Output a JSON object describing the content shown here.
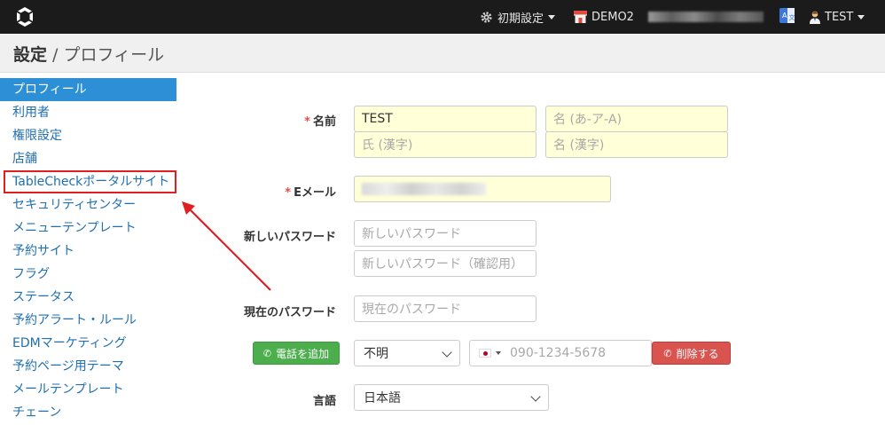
{
  "topbar": {
    "initial_settings": "初期設定",
    "store_name": "DEMO2",
    "user_name": "TEST"
  },
  "header": {
    "title_main": "設定",
    "title_separator": " / ",
    "title_sub": "プロフィール"
  },
  "sidebar": {
    "items": [
      {
        "label": "プロフィール"
      },
      {
        "label": "利用者"
      },
      {
        "label": "権限設定"
      },
      {
        "label": "店舗"
      },
      {
        "label": "TableCheckポータルサイト"
      },
      {
        "label": "セキュリティセンター"
      },
      {
        "label": "メニューテンプレート"
      },
      {
        "label": "予約サイト"
      },
      {
        "label": "フラグ"
      },
      {
        "label": "ステータス"
      },
      {
        "label": "予約アラート・ルール"
      },
      {
        "label": "EDMマーケティング"
      },
      {
        "label": "予約ページ用テーマ"
      },
      {
        "label": "メールテンプレート"
      },
      {
        "label": "チェーン"
      }
    ]
  },
  "form": {
    "required_mark": "*",
    "name_label": "名前",
    "last_name_value": "TEST",
    "first_name_kana_placeholder": "名 (あ-ア-A)",
    "last_name_kanji_placeholder": "氏 (漢字)",
    "first_name_kanji_placeholder": "名 (漢字)",
    "email_label": "Eメール",
    "new_password_label": "新しいパスワード",
    "new_password_placeholder": "新しいパスワード",
    "new_password_confirm_placeholder": "新しいパスワード（確認用）",
    "current_password_label": "現在のパスワード",
    "current_password_placeholder": "現在のパスワード",
    "add_phone_button": "電話を追加",
    "phone_type_value": "不明",
    "phone_placeholder": "090-1234-5678",
    "delete_button": "削除する",
    "language_label": "言語",
    "language_value": "日本語"
  }
}
